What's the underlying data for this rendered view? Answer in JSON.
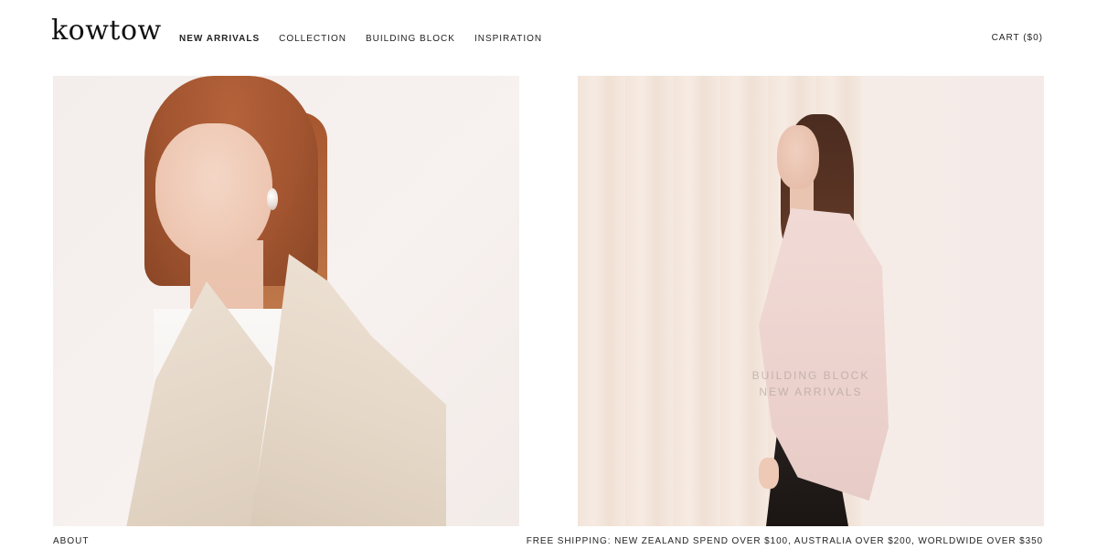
{
  "header": {
    "logo": "kowtow",
    "nav": [
      {
        "label": "NEW ARRIVALS"
      },
      {
        "label": "COLLECTION"
      },
      {
        "label": "BUILDING BLOCK"
      },
      {
        "label": "INSPIRATION"
      }
    ],
    "cart_label": "CART ($0)"
  },
  "panels": {
    "right_overlay_line1": "BUILDING BLOCK",
    "right_overlay_line2": "NEW ARRIVALS"
  },
  "footer": {
    "about_label": "ABOUT",
    "shipping_notice": "FREE SHIPPING: NEW ZEALAND SPEND OVER $100, AUSTRALIA OVER $200, WORLDWIDE OVER $350"
  }
}
